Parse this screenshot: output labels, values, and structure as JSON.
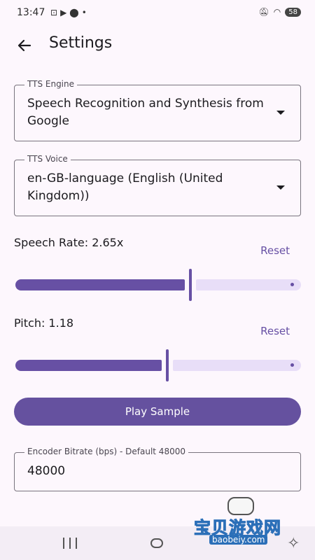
{
  "status_bar": {
    "time": "13:47",
    "left_icons": [
      "screenshot-icon",
      "play-icon",
      "location-icon",
      "dot-icon"
    ],
    "right_icons": [
      "mute-icon",
      "wifi-icon"
    ],
    "battery": "58"
  },
  "app_bar": {
    "title": "Settings",
    "back_icon": "arrow-back-icon"
  },
  "tts_engine": {
    "label": "TTS Engine",
    "value": "Speech Recognition and Synthesis from Google"
  },
  "tts_voice": {
    "label": "TTS Voice",
    "value": "en-GB-language (English (United Kingdom))"
  },
  "speech_rate": {
    "label": "Speech Rate: 2.65x",
    "reset": "Reset",
    "value": 2.65,
    "level": 0.61
  },
  "pitch": {
    "label": "Pitch: 1.18",
    "reset": "Reset",
    "value": 1.18,
    "level": 0.53
  },
  "play_button": {
    "label": "Play Sample"
  },
  "bitrate": {
    "label": "Encoder Bitrate (bps) - Default 48000",
    "value": "48000"
  },
  "watermark": {
    "text": "宝贝游戏网",
    "url": "baobeiy.com"
  },
  "colors": {
    "primary": "#6750a4",
    "track_inactive": "#e8def8",
    "background": "#fdf7fd"
  }
}
